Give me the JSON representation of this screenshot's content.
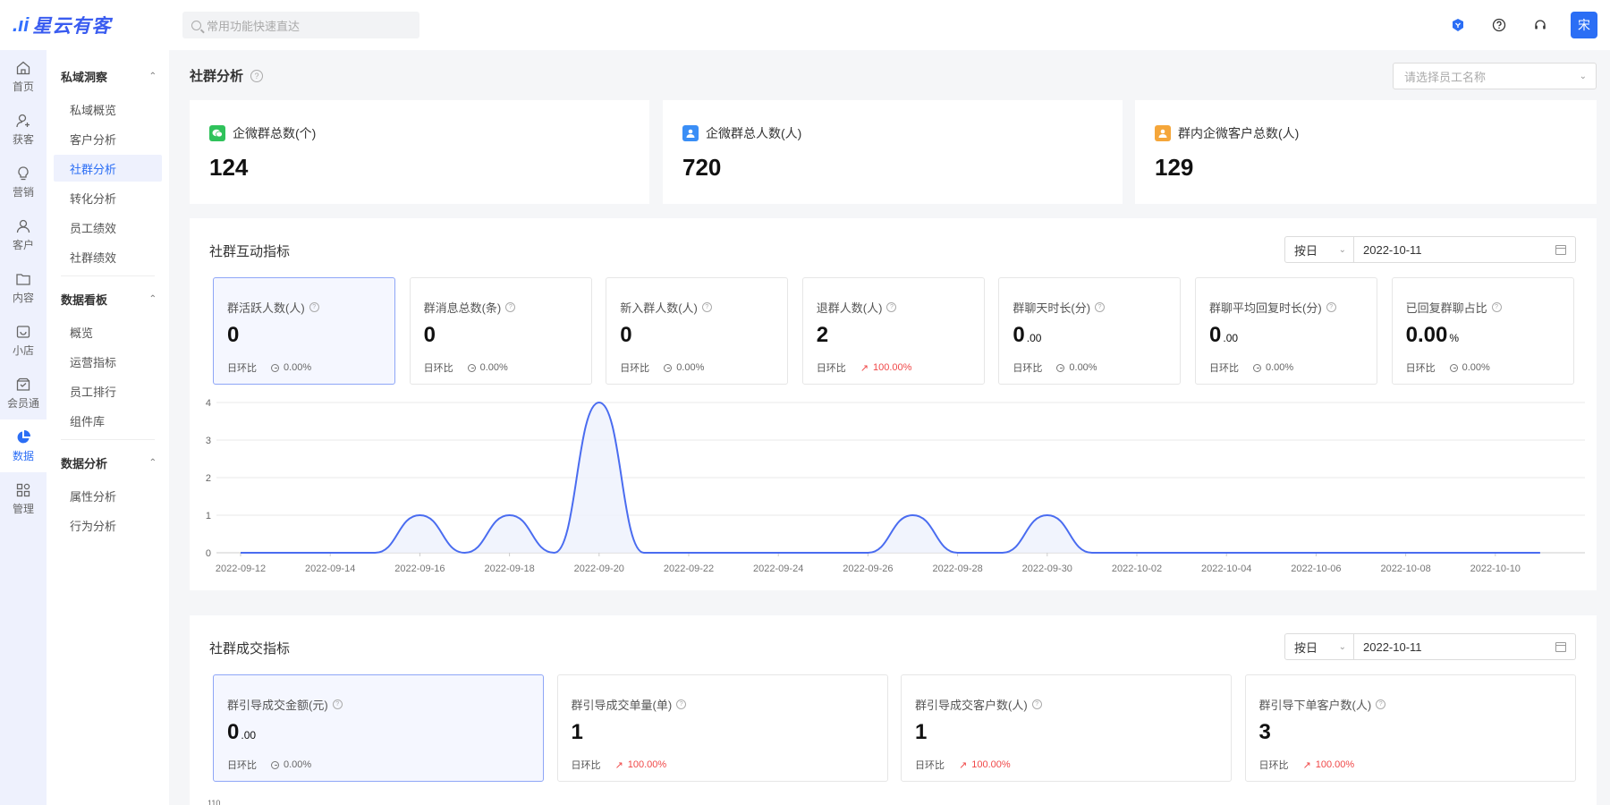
{
  "app": {
    "logo_mark": ".ıi",
    "logo_text": "星云有客"
  },
  "search": {
    "placeholder": "常用功能快速直达"
  },
  "user": {
    "avatar_text": "宋"
  },
  "rail": [
    {
      "label": "首页",
      "icon": "home-icon"
    },
    {
      "label": "获客",
      "icon": "acquire-icon"
    },
    {
      "label": "营销",
      "icon": "bulb-icon"
    },
    {
      "label": "客户",
      "icon": "person-icon"
    },
    {
      "label": "内容",
      "icon": "folder-icon"
    },
    {
      "label": "小店",
      "icon": "shop-icon"
    },
    {
      "label": "会员通",
      "icon": "member-icon"
    },
    {
      "label": "数据",
      "icon": "pie-chart-icon",
      "active": true
    },
    {
      "label": "管理",
      "icon": "grid-icon"
    }
  ],
  "subnav": {
    "groups": [
      {
        "title": "私域洞察",
        "items": [
          "私域概览",
          "客户分析",
          "社群分析",
          "转化分析",
          "员工绩效",
          "社群绩效"
        ]
      },
      {
        "title": "数据看板",
        "items": [
          "概览",
          "运营指标",
          "员工排行",
          "组件库"
        ]
      },
      {
        "title": "数据分析",
        "items": [
          "属性分析",
          "行为分析"
        ]
      }
    ]
  },
  "page": {
    "title": "社群分析",
    "employee_placeholder": "请选择员工名称"
  },
  "kpis": [
    {
      "label": "企微群总数(个)",
      "value": "124",
      "icon": "wechat-group-icon",
      "color": "#2fc25b"
    },
    {
      "label": "企微群总人数(人)",
      "value": "720",
      "icon": "group-members-icon",
      "color": "#3a8ef6"
    },
    {
      "label": "群内企微客户总数(人)",
      "value": "129",
      "icon": "customer-icon",
      "color": "#f5a63a"
    }
  ],
  "interaction": {
    "title": "社群互动指标",
    "granularity": "按日",
    "date": "2022-10-11",
    "metrics": [
      {
        "label": "群活跃人数(人)",
        "value": "0",
        "decimal": "",
        "foot": "日环比",
        "cmp": "0.00%",
        "up": false
      },
      {
        "label": "群消息总数(条)",
        "value": "0",
        "decimal": "",
        "foot": "日环比",
        "cmp": "0.00%",
        "up": false
      },
      {
        "label": "新入群人数(人)",
        "value": "0",
        "decimal": "",
        "foot": "日环比",
        "cmp": "0.00%",
        "up": false
      },
      {
        "label": "退群人数(人)",
        "value": "2",
        "decimal": "",
        "foot": "日环比",
        "cmp": "100.00%",
        "up": true
      },
      {
        "label": "群聊天时长(分)",
        "value": "0",
        "decimal": ".00",
        "foot": "日环比",
        "cmp": "0.00%",
        "up": false
      },
      {
        "label": "群聊平均回复时长(分)",
        "value": "0",
        "decimal": ".00",
        "foot": "日环比",
        "cmp": "0.00%",
        "up": false
      },
      {
        "label": "已回复群聊占比",
        "value": "0.00",
        "decimal": "%",
        "foot": "日环比",
        "cmp": "0.00%",
        "up": false
      }
    ]
  },
  "chart_data": {
    "type": "line",
    "x": [
      "2022-09-11",
      "2022-09-12",
      "2022-09-13",
      "2022-09-14",
      "2022-09-15",
      "2022-09-16",
      "2022-09-17",
      "2022-09-18",
      "2022-09-19",
      "2022-09-20",
      "2022-09-21",
      "2022-09-22",
      "2022-09-23",
      "2022-09-24",
      "2022-09-25",
      "2022-09-26",
      "2022-09-27",
      "2022-09-28",
      "2022-09-29",
      "2022-09-30",
      "2022-10-01",
      "2022-10-02",
      "2022-10-03",
      "2022-10-04",
      "2022-10-05",
      "2022-10-06",
      "2022-10-07",
      "2022-10-08",
      "2022-10-09",
      "2022-10-10",
      "2022-10-11"
    ],
    "tick_labels": [
      "2022-09-12",
      "2022-09-14",
      "2022-09-16",
      "2022-09-18",
      "2022-09-20",
      "2022-09-22",
      "2022-09-24",
      "2022-09-26",
      "2022-09-28",
      "2022-09-30",
      "2022-10-02",
      "2022-10-04",
      "2022-10-06",
      "2022-10-08",
      "2022-10-10"
    ],
    "series": [
      {
        "values": [
          0,
          0,
          0,
          0,
          0,
          1,
          0,
          1,
          0,
          4,
          0,
          0,
          0,
          0,
          0,
          0,
          1,
          0,
          0,
          1,
          0,
          0,
          0,
          0,
          0,
          0,
          0,
          0,
          0,
          0,
          0
        ]
      }
    ],
    "ylim": [
      0,
      4
    ],
    "yticks": [
      0,
      1,
      2,
      3,
      4
    ],
    "grid": true,
    "color": "#4a6cf0"
  },
  "deal": {
    "title": "社群成交指标",
    "granularity": "按日",
    "date": "2022-10-11",
    "metrics": [
      {
        "label": "群引导成交金额(元)",
        "value": "0",
        "decimal": ".00",
        "foot": "日环比",
        "cmp": "0.00%",
        "up": false
      },
      {
        "label": "群引导成交单量(单)",
        "value": "1",
        "decimal": "",
        "foot": "日环比",
        "cmp": "100.00%",
        "up": true
      },
      {
        "label": "群引导成交客户数(人)",
        "value": "1",
        "decimal": "",
        "foot": "日环比",
        "cmp": "100.00%",
        "up": true
      },
      {
        "label": "群引导下单客户数(人)",
        "value": "3",
        "decimal": "",
        "foot": "日环比",
        "cmp": "100.00%",
        "up": true
      }
    ],
    "chart_peek_label": "110"
  }
}
